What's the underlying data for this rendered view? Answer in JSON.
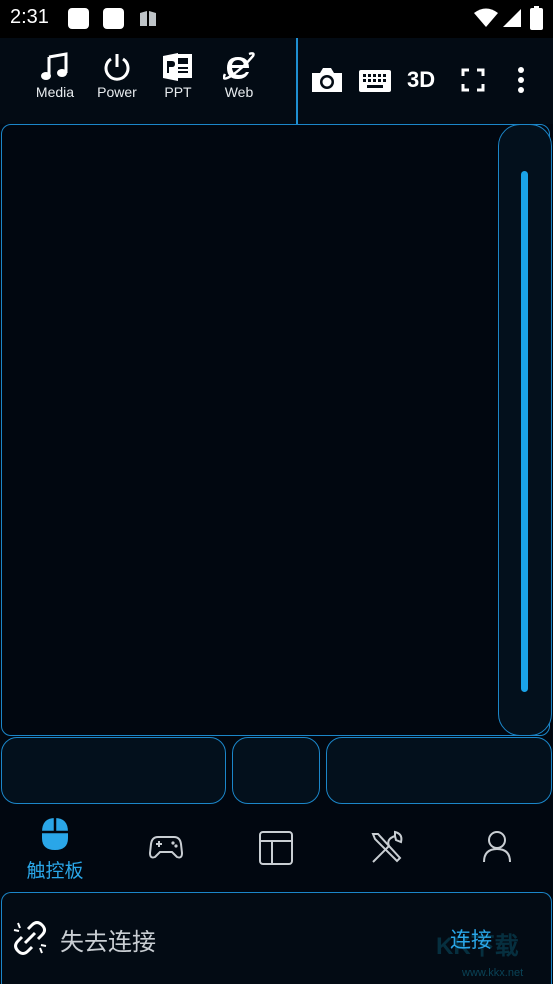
{
  "status_bar": {
    "time": "2:31",
    "icons": [
      "notification-square-icon",
      "notification-square-icon",
      "book-icon",
      "wifi-icon",
      "cellular-icon",
      "battery-icon"
    ]
  },
  "toolbar": {
    "items": [
      {
        "label": "Media",
        "icon": "music-note-icon"
      },
      {
        "label": "Power",
        "icon": "power-icon"
      },
      {
        "label": "PPT",
        "icon": "powerpoint-icon"
      },
      {
        "label": "Web",
        "icon": "internet-explorer-icon"
      }
    ],
    "right": {
      "camera_icon": "camera-icon",
      "keyboard_icon": "keyboard-icon",
      "mode_3d": "3D",
      "fullscreen_icon": "fullscreen-icon",
      "more_icon": "more-vertical-icon"
    }
  },
  "bottom_nav": {
    "items": [
      {
        "label": "触控板",
        "icon": "mouse-icon",
        "active": true
      },
      {
        "label": "",
        "icon": "gamepad-icon",
        "active": false
      },
      {
        "label": "",
        "icon": "layout-icon",
        "active": false
      },
      {
        "label": "",
        "icon": "tools-icon",
        "active": false
      },
      {
        "label": "",
        "icon": "user-icon",
        "active": false
      }
    ]
  },
  "connection": {
    "status": "失去连接",
    "action": "连接",
    "icon": "broken-link-icon"
  },
  "watermark": {
    "text": "KK下载",
    "url": "www.kkx.net"
  },
  "colors": {
    "accent": "#1aa3e8",
    "border": "#1b86c9",
    "background": "#010710"
  }
}
